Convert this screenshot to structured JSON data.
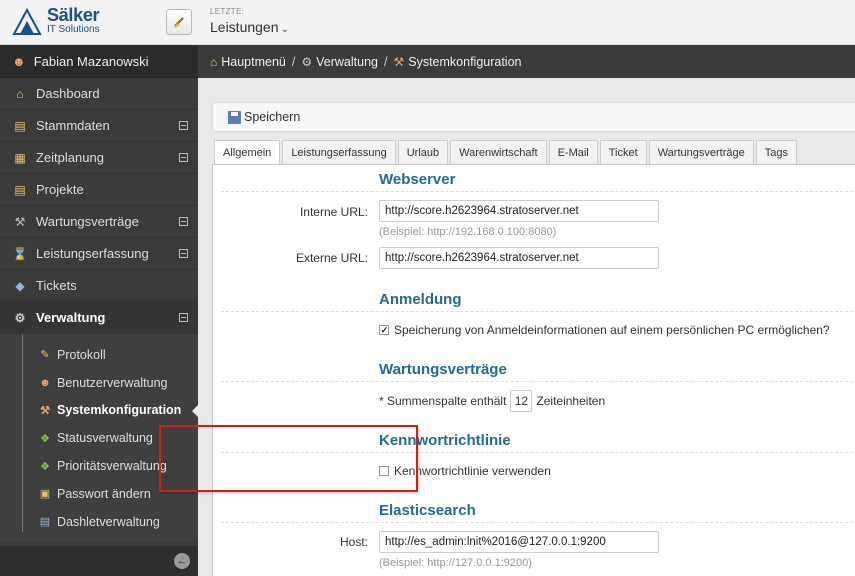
{
  "app": {
    "logo_name": "Sälker",
    "logo_sub": "IT Solutions",
    "recent_label": "LETZTE:",
    "recent_value": "Leistungen"
  },
  "sidebar": {
    "user": "Fabian Mazanowski",
    "items": [
      {
        "label": "Dashboard",
        "icon": "home-icon"
      },
      {
        "label": "Stammdaten",
        "icon": "folder-icon",
        "expandable": true
      },
      {
        "label": "Zeitplanung",
        "icon": "calendar-icon",
        "expandable": true
      },
      {
        "label": "Projekte",
        "icon": "folder-icon"
      },
      {
        "label": "Wartungsverträge",
        "icon": "wrench-icon",
        "expandable": true
      },
      {
        "label": "Leistungserfassung",
        "icon": "hourglass-icon",
        "expandable": true
      },
      {
        "label": "Tickets",
        "icon": "tag-icon"
      },
      {
        "label": "Verwaltung",
        "icon": "gear-icon",
        "expandable": true,
        "active": true
      }
    ],
    "subitems": [
      {
        "label": "Protokoll",
        "icon": "pencil-icon"
      },
      {
        "label": "Benutzerverwaltung",
        "icon": "user-icon"
      },
      {
        "label": "Systemkonfiguration",
        "icon": "wrench-icon",
        "active": true
      },
      {
        "label": "Statusverwaltung",
        "icon": "puzzle-icon"
      },
      {
        "label": "Prioritätsverwaltung",
        "icon": "puzzle-icon"
      },
      {
        "label": "Passwort ändern",
        "icon": "lock-icon"
      },
      {
        "label": "Dashletverwaltung",
        "icon": "layout-icon"
      }
    ]
  },
  "breadcrumb": [
    {
      "label": "Hauptmenü",
      "icon": "home-icon"
    },
    {
      "label": "Verwaltung",
      "icon": "gear-icon"
    },
    {
      "label": "Systemkonfiguration",
      "icon": "wrench-icon"
    }
  ],
  "toolbar": {
    "save_label": "Speichern"
  },
  "tabs": [
    "Allgemein",
    "Leistungserfassung",
    "Urlaub",
    "Warenwirtschaft",
    "E-Mail",
    "Ticket",
    "Wartungsverträge",
    "Tags"
  ],
  "active_tab": "Allgemein",
  "webserver": {
    "title": "Webserver",
    "internal_label": "Interne URL:",
    "internal_value": "http://score.h2623964.stratoserver.net",
    "internal_hint": "(Beispiel: http://192.168.0.100:8080)",
    "external_label": "Externe URL:",
    "external_value": "http://score.h2623964.stratoserver.net"
  },
  "anmeldung": {
    "title": "Anmeldung",
    "checkbox_label": "Speicherung von Anmeldeinformationen auf einem persönlichen PC ermöglichen?",
    "checked": true
  },
  "wartung": {
    "title": "Wartungsverträge",
    "prefix": "* Summenspalte enthält",
    "value": "12",
    "suffix": "Zeiteinheiten"
  },
  "kennwort": {
    "title": "Kennwortrichtlinie",
    "checkbox_label": "Kennwortrichtlinie verwenden",
    "checked": false
  },
  "elastic": {
    "title": "Elasticsearch",
    "host_label": "Host:",
    "host_value": "http://es_admin:lnit%2016@127.0.0.1:9200",
    "host_hint": "(Beispiel: http://127.0.0.1:9200)"
  },
  "colors": {
    "accent": "#256a93",
    "sidebar": "#3b3b3b",
    "highlight": "#cc1f1f"
  }
}
